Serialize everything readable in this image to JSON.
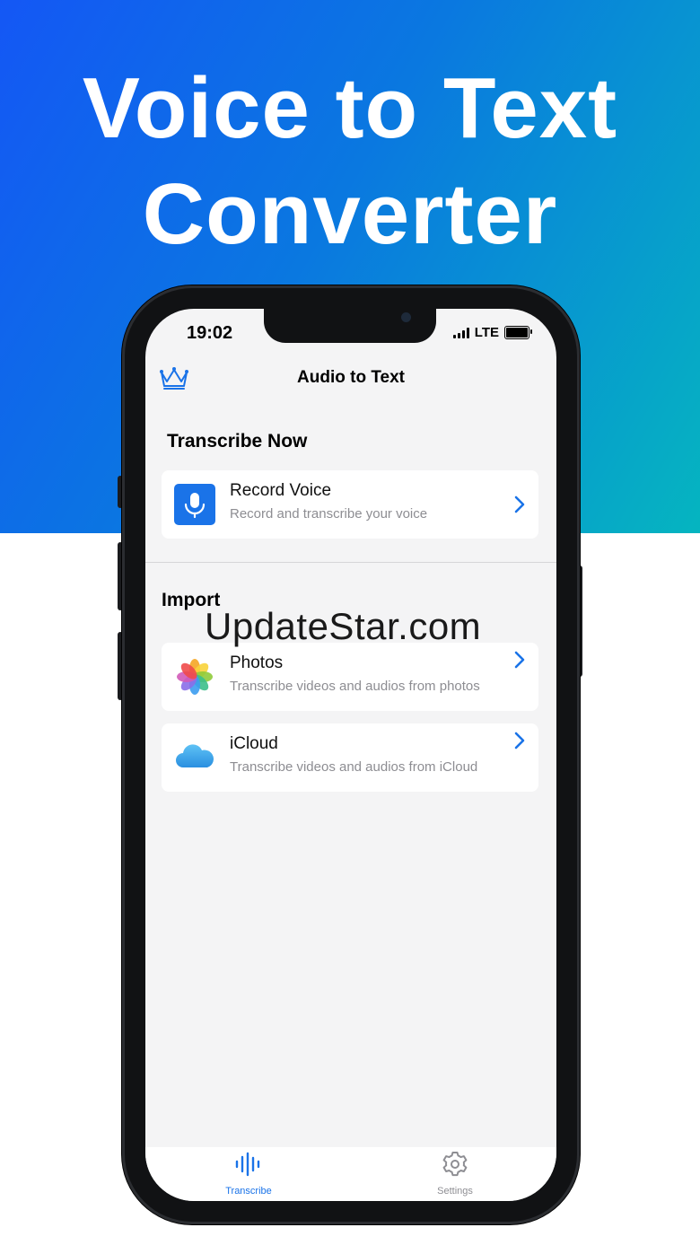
{
  "promo": {
    "headline_line1": "Voice to Text",
    "headline_line2": "Converter"
  },
  "status_bar": {
    "time": "19:02",
    "network": "LTE"
  },
  "nav": {
    "title": "Audio to Text",
    "premium_icon": "crown-icon"
  },
  "transcribe_section": {
    "title": "Transcribe Now",
    "record": {
      "title": "Record Voice",
      "subtitle": "Record and transcribe your voice",
      "icon": "microphone-icon"
    }
  },
  "import_section": {
    "title": "Import",
    "items": [
      {
        "title": "Photos",
        "subtitle": "Transcribe videos and audios from photos",
        "icon": "photos-icon"
      },
      {
        "title": "iCloud",
        "subtitle": "Transcribe videos and audios from iCloud",
        "icon": "icloud-icon"
      }
    ]
  },
  "watermark": "UpdateStar.com",
  "tab_bar": {
    "tabs": [
      {
        "label": "Transcribe",
        "icon": "waveform-icon",
        "active": true
      },
      {
        "label": "Settings",
        "icon": "gear-icon",
        "active": false
      }
    ]
  },
  "colors": {
    "accent": "#1a73e8",
    "inactive_tab": "#8e8e93",
    "gradient_start": "#1457f5",
    "gradient_end": "#05b5c0"
  }
}
